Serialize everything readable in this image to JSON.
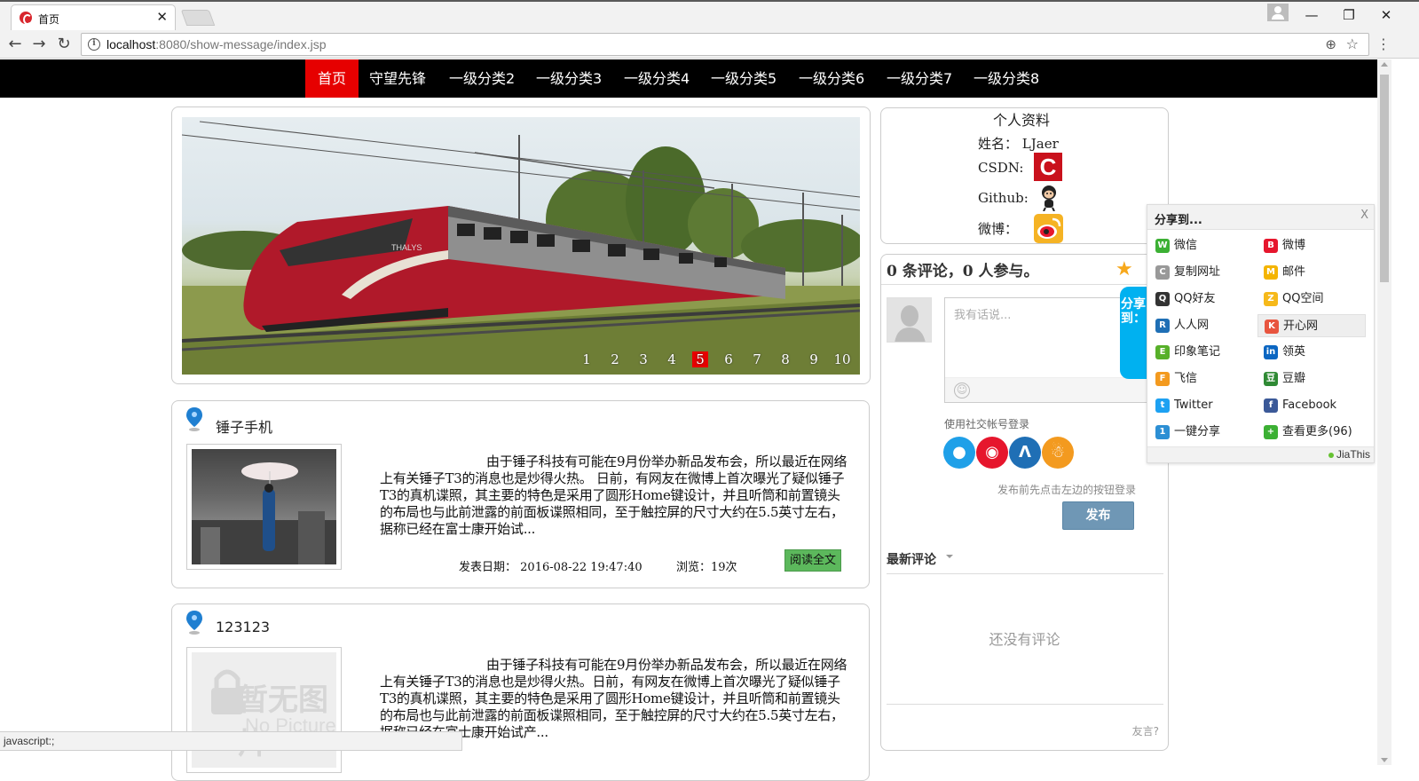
{
  "browser": {
    "tab_title": "首页",
    "tab_close": "✕",
    "url_host": "localhost",
    "url_path": ":8080/show-message/index.jsp",
    "status_text": "javascript:;"
  },
  "site_nav": {
    "items": [
      {
        "label": "首页",
        "active": true
      },
      {
        "label": "守望先锋"
      },
      {
        "label": "一级分类2"
      },
      {
        "label": "一级分类3"
      },
      {
        "label": "一级分类4"
      },
      {
        "label": "一级分类5"
      },
      {
        "label": "一级分类6"
      },
      {
        "label": "一级分类7"
      },
      {
        "label": "一级分类8"
      }
    ]
  },
  "slider": {
    "pages": [
      "1",
      "2",
      "3",
      "4",
      "5",
      "6",
      "7",
      "8",
      "9",
      "10"
    ],
    "active_page": "5",
    "brand_text": "THALYS"
  },
  "articles": [
    {
      "title": "锤子手机",
      "body": "由于锤子科技有可能在9月份举办新品发布会，所以最近在网络上有关锤子T3的消息也是炒得火热。 日前，有网友在微博上首次曝光了疑似锤子T3的真机谍照，其主要的特色是采用了圆形Home键设计，并且听筒和前置镜头的布局也与此前泄露的前面板谍照相同，至于触控屏的尺寸大约在5.5英寸左右，据称已经在富士康开始试...",
      "date_label": "发表日期：",
      "date": "2016-08-22 19:47:40",
      "views": "浏览：19次",
      "read_more": "阅读全文"
    },
    {
      "title": "123123",
      "body": "由于锤子科技有可能在9月份举办新品发布会，所以最近在网络上有关锤子T3的消息也是炒得火热。日前，有网友在微博上首次曝光了疑似锤子T3的真机谍照，其主要的特色是采用了圆形Home键设计，并且听筒和前置镜头的布局也与此前泄露的前面板谍照相同，至于触控屏的尺寸大约在5.5英寸左右，据称已经在富士康开始试产...",
      "no_image_text": "暂无图片",
      "no_image_en": "No Picture"
    }
  ],
  "profile": {
    "title": "个人资料",
    "name_label": "姓名：",
    "name_value": "LJaer",
    "csdn_label": "CSDN:",
    "github_label": "Github:",
    "weibo_label": "微博："
  },
  "comments": {
    "count_text": "0 条评论，0 人参与。",
    "placeholder": "我有话说...",
    "share_tab": "分享到：",
    "social_login_label": "使用社交帐号登录",
    "login_hint": "发布前先点击左边的按钮登录",
    "publish": "发布",
    "latest_label": "最新评论",
    "empty_text": "还没有评论",
    "faq": "友言?"
  },
  "share_popup": {
    "title": "分享到...",
    "close": "X",
    "items": [
      {
        "label": "微信",
        "color": "#3cb034",
        "glyph": "W"
      },
      {
        "label": "微博",
        "color": "#e6162d",
        "glyph": "B"
      },
      {
        "label": "复制网址",
        "color": "#999999",
        "glyph": "C"
      },
      {
        "label": "邮件",
        "color": "#f4b400",
        "glyph": "M"
      },
      {
        "label": "QQ好友",
        "color": "#333333",
        "glyph": "Q"
      },
      {
        "label": "QQ空间",
        "color": "#f6b91a",
        "glyph": "Z"
      },
      {
        "label": "人人网",
        "color": "#1f6fb5",
        "glyph": "R"
      },
      {
        "label": "开心网",
        "color": "#e8553f",
        "glyph": "K"
      },
      {
        "label": "印象笔记",
        "color": "#57b029",
        "glyph": "E"
      },
      {
        "label": "领英",
        "color": "#0b66c2",
        "glyph": "in"
      },
      {
        "label": "飞信",
        "color": "#f39a1f",
        "glyph": "F"
      },
      {
        "label": "豆瓣",
        "color": "#2f8a34",
        "glyph": "豆"
      },
      {
        "label": "Twitter",
        "color": "#1da1f2",
        "glyph": "t"
      },
      {
        "label": "Facebook",
        "color": "#3b5998",
        "glyph": "f"
      },
      {
        "label": "一键分享",
        "color": "#2c8fd4",
        "glyph": "1"
      },
      {
        "label": "查看更多(96)",
        "color": "#3cb034",
        "glyph": "+"
      }
    ],
    "brand": "JiaThis"
  },
  "colors": {
    "nav_active": "#e60000",
    "readmore_green": "#5cb85c",
    "publish_blue": "#6f97b5",
    "share_tab_blue": "#00b1f0"
  }
}
